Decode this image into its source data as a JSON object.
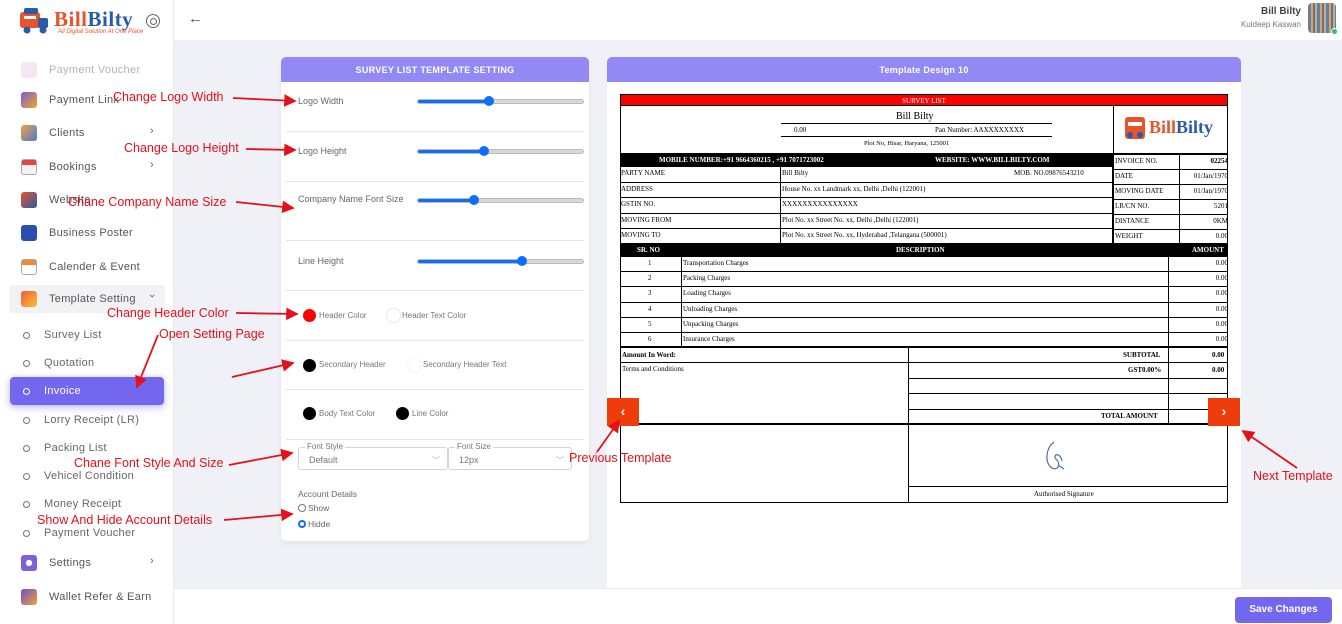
{
  "brand": {
    "logo_text_a": "Bill",
    "logo_text_b": "Bilty",
    "logo_tagline": "All Digital Solution At One Place"
  },
  "sidebar": {
    "items": [
      {
        "label": "Payment Voucher"
      },
      {
        "label": "Payment Link"
      },
      {
        "label": "Clients"
      },
      {
        "label": "Bookings"
      },
      {
        "label": "Website"
      },
      {
        "label": "Business Poster"
      },
      {
        "label": "Calender & Event"
      },
      {
        "label": "Template Setting"
      },
      {
        "label": "Settings"
      },
      {
        "label": "Wallet Refer & Earn"
      }
    ],
    "sub_items": [
      {
        "label": "Survey List"
      },
      {
        "label": "Quotation"
      },
      {
        "label": "Invoice"
      },
      {
        "label": "Lorry Receipt (LR)"
      },
      {
        "label": "Packing List"
      },
      {
        "label": "Vehicel Condition"
      },
      {
        "label": "Money Receipt"
      },
      {
        "label": "Payment Voucher"
      }
    ]
  },
  "header": {
    "user_name": "Bill Bilty",
    "user_sub": "Kuldeep Kaswan"
  },
  "settings_panel": {
    "title": "SURVEY LIST TEMPLATE SETTING",
    "logo_width": {
      "label": "Logo Width",
      "value": 0.43
    },
    "logo_height": {
      "label": "Logo Height",
      "value": 0.4
    },
    "company_name_size": {
      "label": "Company Name Font Size",
      "value": 0.34
    },
    "line_height": {
      "label": "Line Height",
      "value": 0.63
    },
    "header_color": {
      "label": "Header Color",
      "color": "#ff0000"
    },
    "header_text_color": {
      "label": "Header Text Color",
      "color": "#ffffff"
    },
    "secondary_header": {
      "label": "Secondary Header",
      "color": "#000000"
    },
    "secondary_header_text": {
      "label": "Secondary Header Text",
      "color": "#ffffff"
    },
    "body_text_color": {
      "label": "Body Text Color",
      "color": "#000000"
    },
    "line_color": {
      "label": "Line Color",
      "color": "#000000"
    },
    "font_style": {
      "legend": "Font Style",
      "value": "Default"
    },
    "font_size": {
      "legend": "Font Size",
      "value": "12px"
    },
    "account_details": {
      "label": "Account Details",
      "show": "Show",
      "hide": "Hidde",
      "selected": "Hidde"
    }
  },
  "template_panel": {
    "title": "Template Design 10",
    "invoice": {
      "banner": "SURVEY LIST",
      "company": "Bill Bilty",
      "gst": "0.00",
      "pan": "Pan Number: AAXXXXXXXX",
      "address": "Plot No, Hisar, Haryana, 125001",
      "mobile": "MOBILE NUMBER:+91 9664360215 , +91 7071723002",
      "website": "WEBSITE: WWW.BILLBILTY.COM",
      "left_rows": [
        {
          "k": "PARTY NAME",
          "v": "Bill Bilty",
          "extra": "MOB. NO.09876543210"
        },
        {
          "k": "ADDRESS",
          "v": "House No. xx Landmark xx, Delhi ,Delhi (122001)",
          "extra": ""
        },
        {
          "k": "GSTIN NO.",
          "v": "XXXXXXXXXXXXXXX",
          "extra": ""
        },
        {
          "k": "MOVING FROM",
          "v": "Plot No. xx Street No. xx, Delhi ,Delhi (122001)",
          "extra": ""
        },
        {
          "k": "MOVING TO",
          "v": "Plot No. xx Street No. xx, Hyderabad ,Telangana (500001)",
          "extra": ""
        }
      ],
      "right_rows": [
        {
          "k": "INVOICE NO.",
          "v": "02254"
        },
        {
          "k": "DATE",
          "v": "01/Jan/1970"
        },
        {
          "k": "MOVING DATE",
          "v": "01/Jan/1970"
        },
        {
          "k": "LR/CN NO.",
          "v": "5201"
        },
        {
          "k": "DISTANCE",
          "v": "0KM"
        },
        {
          "k": "WEIGHT",
          "v": "0.00"
        }
      ],
      "col_sr": "SR. NO",
      "col_desc": "DESCRIPTION",
      "col_amount": "AMOUNT",
      "lines": [
        {
          "sr": "1",
          "desc": "Transportation Charges",
          "amt": "0.00"
        },
        {
          "sr": "2",
          "desc": "Packing Charges",
          "amt": "0.00"
        },
        {
          "sr": "3",
          "desc": "Loading Charges",
          "amt": "0.00"
        },
        {
          "sr": "4",
          "desc": "Unloading Charges",
          "amt": "0.00"
        },
        {
          "sr": "5",
          "desc": "Unpacking Charges",
          "amt": "0.00"
        },
        {
          "sr": "6",
          "desc": "Insurance Charges",
          "amt": "0.00"
        }
      ],
      "amount_in_word": "Amount In Word:",
      "terms": "Terms and Conditions",
      "subtotal_label": "SUBTOTAL",
      "subtotal": "0.00",
      "gst_label": "GST0.00%",
      "total_label": "TOTAL AMOUNT",
      "signature": "Authorised Signature"
    },
    "prev_glyph": "‹",
    "next_glyph": "›"
  },
  "annotations": {
    "logo_width": "Change Logo Width",
    "logo_height": "Change Logo Height",
    "company_name": "Chane Company Name Size",
    "header_color": "Change Header Color",
    "open_setting": "Open Setting Page",
    "font_style": "Chane Font Style And Size",
    "account": "Show And Hide Account Details",
    "prev": "Previous Template",
    "next": "Next Template"
  },
  "footer": {
    "save_label": "Save Changes"
  },
  "icons": {
    "back": "arrow-left-icon",
    "settings": "settings-cog-icon",
    "chevron": "chevron-right-icon"
  },
  "colors": {
    "accent": "#7367f0",
    "annotation": "#e4101a",
    "nav_arrow": "#ee3d0b",
    "invoice_header": "#ff0000"
  }
}
